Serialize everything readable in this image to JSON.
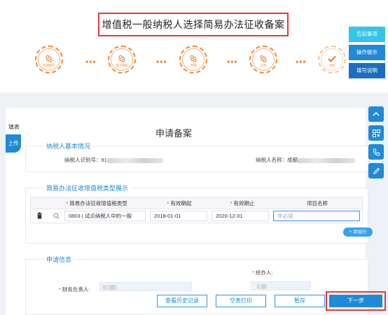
{
  "header": {
    "title": "增值税一般纳税人选择简易办法征收备案"
  },
  "steps": [
    {
      "label": "申请填写",
      "icon": "process-icon"
    },
    {
      "label": "提交审核",
      "icon": "process-icon"
    },
    {
      "label": "预审",
      "icon": "process-icon"
    },
    {
      "label": "同步",
      "icon": "process-icon"
    },
    {
      "label": "办结",
      "icon": "check-icon"
    }
  ],
  "step_connector": "•••",
  "side_buttons": {
    "notice": "告知事项",
    "hint": "操作提示",
    "guide": "填写说明"
  },
  "left_tabs": {
    "fill": "填表",
    "upload": "上传"
  },
  "form": {
    "title": "申请备案",
    "taxpayer_section": {
      "title": "纳税人基本情况",
      "id_label": "纳税人识别号：",
      "id_value": "91",
      "name_label": "纳税人名称：",
      "name_value": "成都"
    },
    "type_section": {
      "title": "简易办法征收增值税类型展示",
      "columns": [
        "简易办法征收增值税类型",
        "有效期起",
        "有效期止",
        "项目名称"
      ],
      "row": {
        "type_value": "0803 | 试点纳税人中的一般",
        "start": "2018-01-01",
        "end": "2020-12-31",
        "project_placeholder": "非必填"
      },
      "add_row": "+ 添加行"
    },
    "apply_section": {
      "title": "申请信息",
      "handler_label": "经办人:",
      "finance_label": "财务负责人:"
    }
  },
  "bottom_buttons": {
    "history": "查看历史记录",
    "print": "空表打印",
    "save": "暂存",
    "next": "下一步"
  },
  "colors": {
    "primary": "#1f8ad6",
    "accent_orange": "#f08a3a",
    "highlight_red": "#e53935",
    "light_blue": "#36c4ea"
  }
}
